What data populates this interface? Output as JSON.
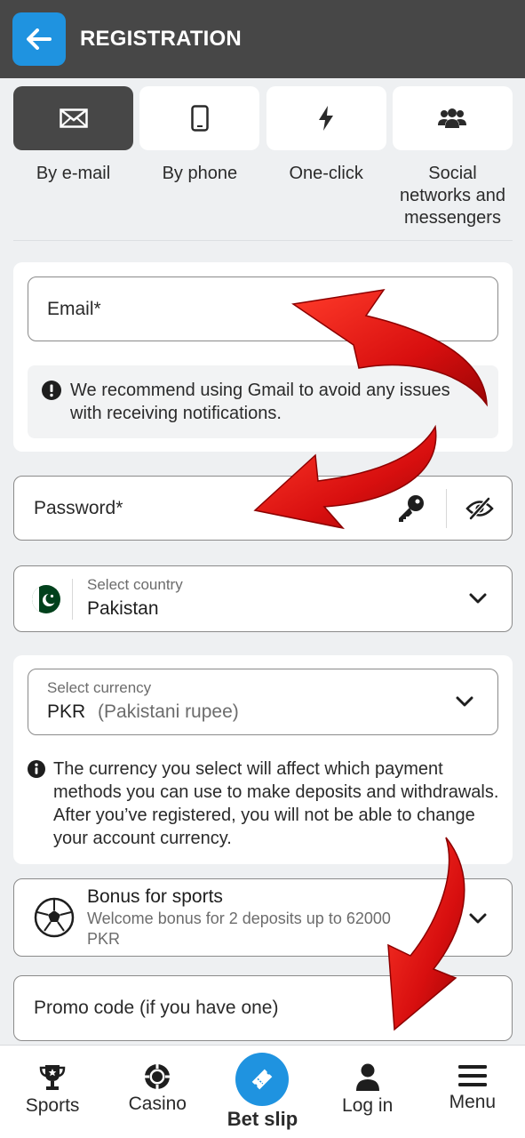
{
  "header": {
    "title": "REGISTRATION"
  },
  "tabs": [
    {
      "label": "By e-mail",
      "icon": "envelope-icon",
      "active": true
    },
    {
      "label": "By phone",
      "icon": "phone-icon",
      "active": false
    },
    {
      "label": "One-click",
      "icon": "lightning-icon",
      "active": false
    },
    {
      "label": "Social networks and messengers",
      "icon": "users-icon",
      "active": false
    }
  ],
  "form": {
    "email_placeholder": "Email*",
    "gmail_notice": "We recommend using Gmail to avoid any issues with receiving notifications.",
    "password_placeholder": "Password*",
    "country": {
      "label": "Select country",
      "value": "Pakistan"
    },
    "currency": {
      "label": "Select currency",
      "code": "PKR",
      "name": "(Pakistani rupee)"
    },
    "currency_notice": "The currency you select will affect which payment methods you can use to make deposits and withdrawals. After you’ve registered, you will not be able to change your account currency.",
    "bonus": {
      "title": "Bonus for sports",
      "description_line1": "Welcome bonus for 2 deposits up to 62000",
      "description_line2": "PKR"
    },
    "promo_placeholder": "Promo code (if you have one)"
  },
  "bottom_nav": [
    {
      "label": "Sports",
      "icon": "trophy-icon"
    },
    {
      "label": "Casino",
      "icon": "casino-chip-icon"
    },
    {
      "label": "Bet slip",
      "icon": "ticket-icon"
    },
    {
      "label": "Log in",
      "icon": "user-icon"
    },
    {
      "label": "Menu",
      "icon": "hamburger-icon"
    }
  ],
  "colors": {
    "header_bg": "#474747",
    "accent": "#1f93e0",
    "arrow": "#e01010"
  }
}
